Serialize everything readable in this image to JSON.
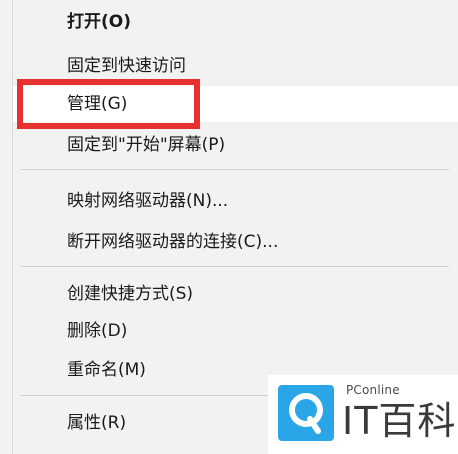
{
  "menu": {
    "items": [
      {
        "label": "打开(O)",
        "bold": true
      },
      {
        "label": "固定到快速访问"
      },
      {
        "label": "管理(G)",
        "hovered": true
      },
      {
        "label": "固定到\"开始\"屏幕(P)"
      },
      {
        "label": "映射网络驱动器(N)..."
      },
      {
        "label": "断开网络驱动器的连接(C)..."
      },
      {
        "label": "创建快捷方式(S)"
      },
      {
        "label": "删除(D)"
      },
      {
        "label": "重命名(M)"
      },
      {
        "label": "属性(R)"
      }
    ]
  },
  "highlight": {
    "color": "#e8302f"
  },
  "watermark": {
    "small_text": "PConline",
    "big_text": "IT百科",
    "accent": "#2aa5e8",
    "logo_icon": "magnifier-logo-icon"
  }
}
